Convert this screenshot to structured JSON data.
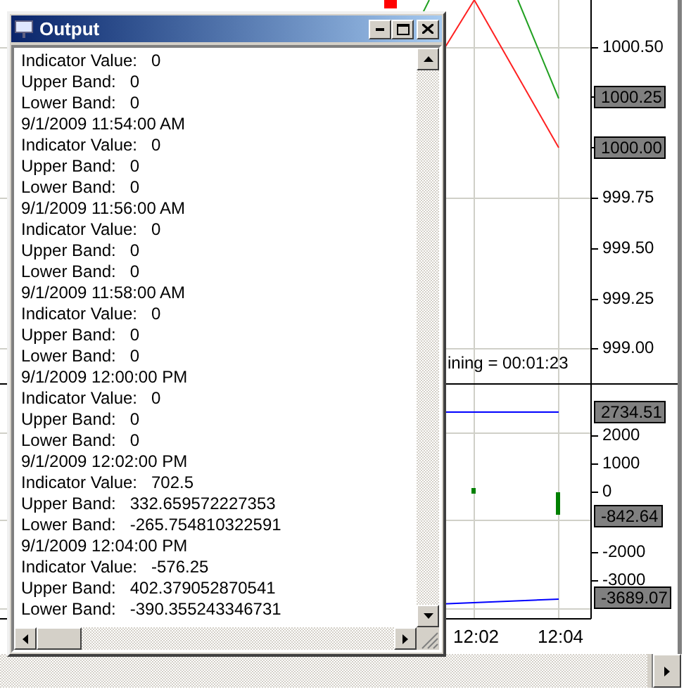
{
  "output_window": {
    "title": "Output",
    "lines": [
      "Indicator Value:   0",
      "Upper Band:   0",
      "Lower Band:   0",
      "9/1/2009 11:54:00 AM",
      "Indicator Value:   0",
      "Upper Band:   0",
      "Lower Band:   0",
      "9/1/2009 11:56:00 AM",
      "Indicator Value:   0",
      "Upper Band:   0",
      "Lower Band:   0",
      "9/1/2009 11:58:00 AM",
      "Indicator Value:   0",
      "Upper Band:   0",
      "Lower Band:   0",
      "9/1/2009 12:00:00 PM",
      "Indicator Value:   0",
      "Upper Band:   0",
      "Lower Band:   0",
      "9/1/2009 12:02:00 PM",
      "Indicator Value:   702.5",
      "Upper Band:   332.659572227353",
      "Lower Band:   -265.754810322591",
      "9/1/2009 12:04:00 PM",
      "Indicator Value:   -576.25",
      "Upper Band:   402.379052870541",
      "Lower Band:   -390.355243346731"
    ]
  },
  "price_panel": {
    "axis_labels": [
      "1000.50",
      "999.75",
      "999.50",
      "999.25",
      "999.00"
    ],
    "markers": [
      "1000.25",
      "1000.00"
    ],
    "status_text": "ining = 00:01:23"
  },
  "indicator_panel": {
    "axis_labels": [
      "2000",
      "1000",
      "0",
      "-2000",
      "-3000"
    ],
    "markers": [
      "2734.51",
      "-842.64",
      "-3689.07"
    ]
  },
  "time_labels": [
    "12:02",
    "12:04"
  ]
}
